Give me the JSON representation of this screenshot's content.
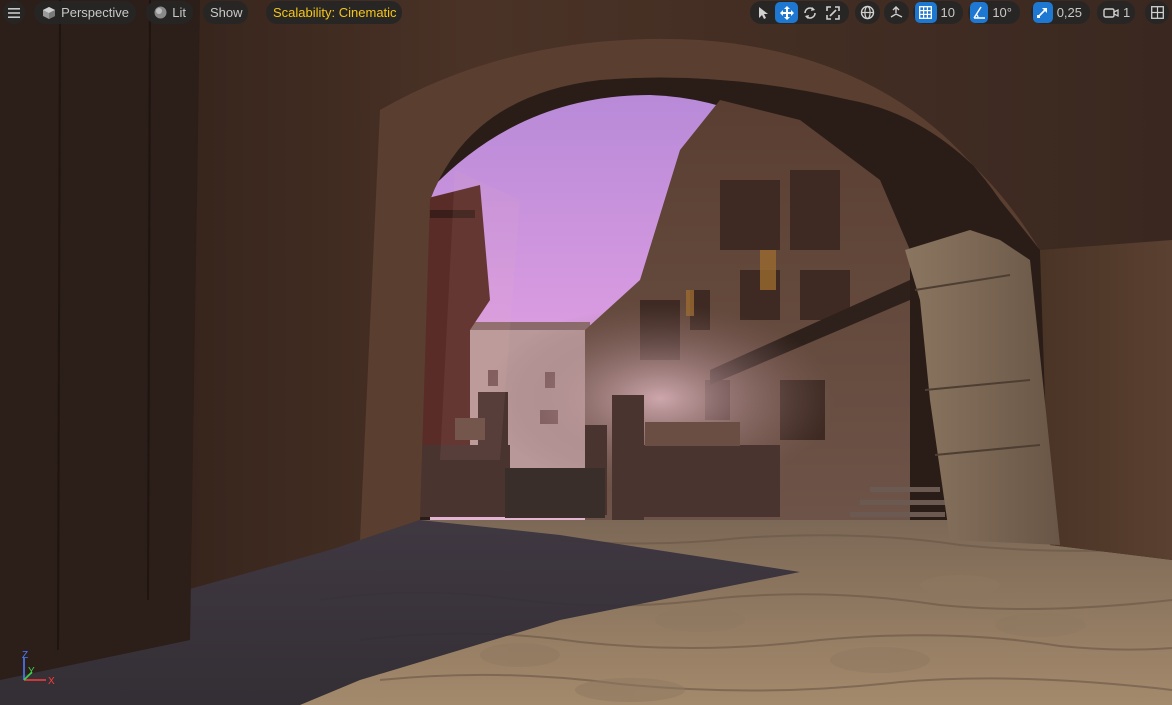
{
  "toolbar": {
    "menu_icon": "hamburger-menu-icon",
    "view_mode": "Perspective",
    "lighting_mode": "Lit",
    "show_label": "Show",
    "scalability": "Scalability: Cinematic",
    "grid_snap_value": "10",
    "rotation_snap_value": "10°",
    "scale_snap_value": "0,25",
    "camera_speed_value": "1"
  },
  "gizmo": {
    "x": "X",
    "y": "Y",
    "z": "Z"
  },
  "colors": {
    "accent": "#1e78d2",
    "scalability_text": "#f5c518",
    "toolbar_bg": "#262626"
  }
}
